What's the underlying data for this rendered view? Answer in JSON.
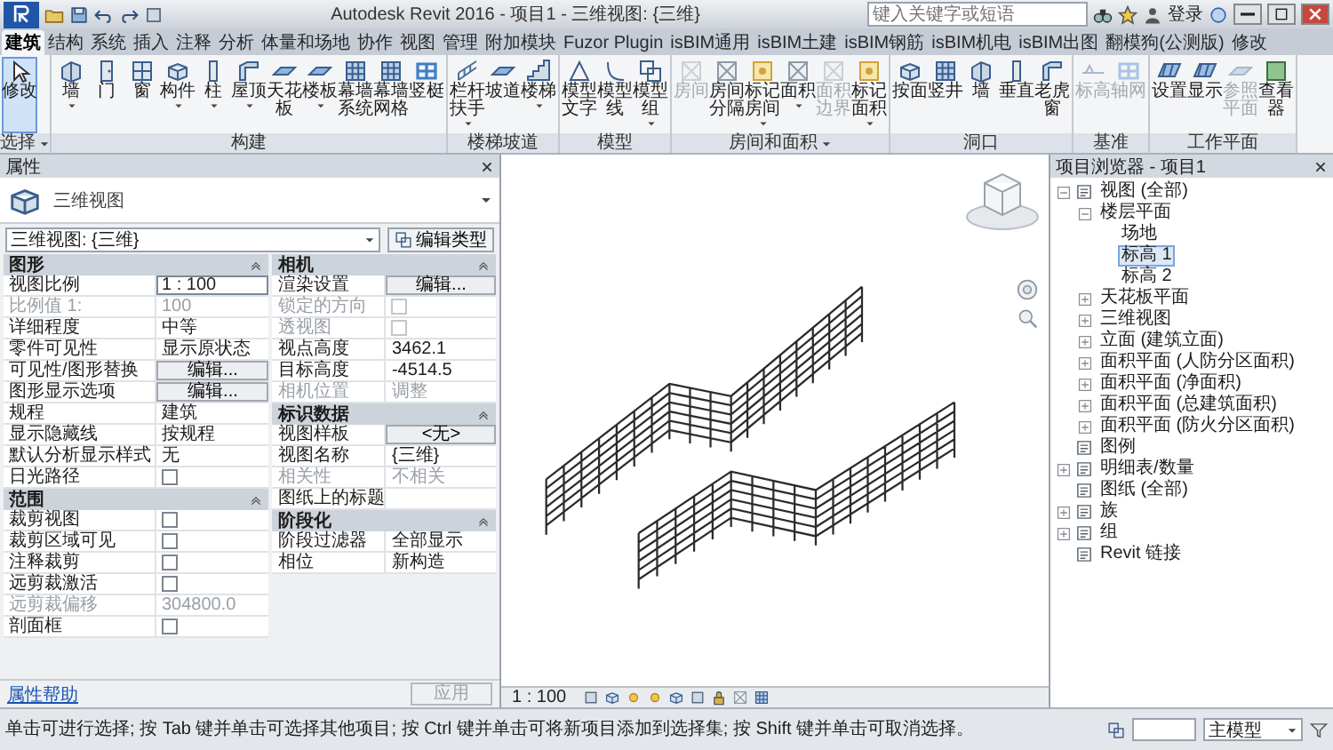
{
  "title_bar": {
    "title": "Autodesk Revit 2016 -   项目1 - 三维视图: {三维}",
    "search": {
      "placeholder": "键入关键字或短语"
    },
    "login": "登录"
  },
  "ribbon_tabs": [
    {
      "label": "建筑",
      "selected": true
    },
    {
      "label": "结构",
      "selected": false
    },
    {
      "label": "系统",
      "selected": false
    },
    {
      "label": "插入",
      "selected": false
    },
    {
      "label": "注释",
      "selected": false
    },
    {
      "label": "分析",
      "selected": false
    },
    {
      "label": "体量和场地",
      "selected": false
    },
    {
      "label": "协作",
      "selected": false
    },
    {
      "label": "视图",
      "selected": false
    },
    {
      "label": "管理",
      "selected": false
    },
    {
      "label": "附加模块",
      "selected": false
    },
    {
      "label": "Fuzor Plugin",
      "selected": false
    },
    {
      "label": "isBIM通用",
      "selected": false
    },
    {
      "label": "isBIM土建",
      "selected": false
    },
    {
      "label": "isBIM钢筋",
      "selected": false
    },
    {
      "label": "isBIM机电",
      "selected": false
    },
    {
      "label": "isBIM出图",
      "selected": false
    },
    {
      "label": "翻模狗(公测版)",
      "selected": false
    },
    {
      "label": "修改",
      "selected": false
    }
  ],
  "ribbon_panels": [
    {
      "name": "选择",
      "has_menu": true,
      "tools": [
        {
          "label": "修改",
          "active": true,
          "disabled": false,
          "dropdown": false
        }
      ]
    },
    {
      "name": "构建",
      "has_menu": false,
      "tools": [
        {
          "label": "墙",
          "active": false,
          "disabled": false,
          "dropdown": true
        },
        {
          "label": "门",
          "active": false,
          "disabled": false,
          "dropdown": false
        },
        {
          "label": "窗",
          "active": false,
          "disabled": false,
          "dropdown": false
        },
        {
          "label": "构件",
          "active": false,
          "disabled": false,
          "dropdown": true
        },
        {
          "label": "柱",
          "active": false,
          "disabled": false,
          "dropdown": true
        },
        {
          "label": "屋顶",
          "active": false,
          "disabled": false,
          "dropdown": true
        },
        {
          "label": "天花板",
          "active": false,
          "disabled": false,
          "dropdown": false
        },
        {
          "label": "楼板",
          "active": false,
          "disabled": false,
          "dropdown": true
        },
        {
          "label": "幕墙系统",
          "active": false,
          "disabled": false,
          "dropdown": false
        },
        {
          "label": "幕墙网格",
          "active": false,
          "disabled": false,
          "dropdown": false
        },
        {
          "label": "竖梃",
          "active": false,
          "disabled": false,
          "dropdown": false
        }
      ]
    },
    {
      "name": "楼梯坡道",
      "has_menu": false,
      "tools": [
        {
          "label": "栏杆扶手",
          "active": false,
          "disabled": false,
          "dropdown": true
        },
        {
          "label": "坡道",
          "active": false,
          "disabled": false,
          "dropdown": false
        },
        {
          "label": "楼梯",
          "active": false,
          "disabled": false,
          "dropdown": true
        }
      ]
    },
    {
      "name": "模型",
      "has_menu": false,
      "tools": [
        {
          "label": "模型文字",
          "active": false,
          "disabled": false,
          "dropdown": false
        },
        {
          "label": "模型线",
          "active": false,
          "disabled": false,
          "dropdown": false
        },
        {
          "label": "模型组",
          "active": false,
          "disabled": false,
          "dropdown": true
        }
      ]
    },
    {
      "name": "房间和面积",
      "has_menu": true,
      "tools": [
        {
          "label": "房间",
          "active": false,
          "disabled": true,
          "dropdown": false
        },
        {
          "label": "房间分隔",
          "active": false,
          "disabled": false,
          "dropdown": false
        },
        {
          "label": "标记房间",
          "active": false,
          "disabled": false,
          "dropdown": true
        },
        {
          "label": "面积",
          "active": false,
          "disabled": false,
          "dropdown": true
        },
        {
          "label": "面积边界",
          "active": false,
          "disabled": true,
          "dropdown": false
        },
        {
          "label": "标记面积",
          "active": false,
          "disabled": false,
          "dropdown": true
        }
      ]
    },
    {
      "name": "洞口",
      "has_menu": false,
      "tools": [
        {
          "label": "按面",
          "active": false,
          "disabled": false,
          "dropdown": false
        },
        {
          "label": "竖井",
          "active": false,
          "disabled": false,
          "dropdown": false
        },
        {
          "label": "墙",
          "active": false,
          "disabled": false,
          "dropdown": false
        },
        {
          "label": "垂直",
          "active": false,
          "disabled": false,
          "dropdown": false
        },
        {
          "label": "老虎窗",
          "active": false,
          "disabled": false,
          "dropdown": false
        }
      ]
    },
    {
      "name": "基准",
      "has_menu": false,
      "tools": [
        {
          "label": "标高",
          "active": false,
          "disabled": true,
          "dropdown": false
        },
        {
          "label": "轴网",
          "active": false,
          "disabled": true,
          "dropdown": false
        }
      ]
    },
    {
      "name": "工作平面",
      "has_menu": false,
      "tools": [
        {
          "label": "设置",
          "active": false,
          "disabled": false,
          "dropdown": false
        },
        {
          "label": "显示",
          "active": false,
          "disabled": false,
          "dropdown": false
        },
        {
          "label": "参照平面",
          "active": false,
          "disabled": true,
          "dropdown": false
        },
        {
          "label": "查看器",
          "active": false,
          "disabled": false,
          "dropdown": false
        }
      ]
    }
  ],
  "properties": {
    "title": "属性",
    "type_name": "三维视图",
    "type_selector": "三维视图: {三维}",
    "edit_type": "编辑类型",
    "groups": [
      {
        "name": "图形",
        "rows": [
          {
            "label": "视图比例",
            "kind": "field",
            "value": "1 : 100",
            "disabled": false
          },
          {
            "label": "比例值 1:",
            "kind": "text",
            "value": "100",
            "disabled": true
          },
          {
            "label": "详细程度",
            "kind": "text",
            "value": "中等",
            "disabled": false
          },
          {
            "label": "零件可见性",
            "kind": "text",
            "value": "显示原状态",
            "disabled": false
          },
          {
            "label": "可见性/图形替换",
            "kind": "button",
            "value": "编辑...",
            "disabled": false
          },
          {
            "label": "图形显示选项",
            "kind": "button",
            "value": "编辑...",
            "disabled": false
          },
          {
            "label": "规程",
            "kind": "text",
            "value": "建筑",
            "disabled": false
          },
          {
            "label": "显示隐藏线",
            "kind": "text",
            "value": "按规程",
            "disabled": false
          },
          {
            "label": "默认分析显示样式",
            "kind": "text",
            "value": "无",
            "disabled": false
          },
          {
            "label": "日光路径",
            "kind": "checkbox",
            "checked": false,
            "disabled": false
          }
        ]
      },
      {
        "name": "范围",
        "rows": [
          {
            "label": "裁剪视图",
            "kind": "checkbox",
            "checked": false,
            "disabled": false
          },
          {
            "label": "裁剪区域可见",
            "kind": "checkbox",
            "checked": false,
            "disabled": false
          },
          {
            "label": "注释裁剪",
            "kind": "checkbox",
            "checked": false,
            "disabled": false
          },
          {
            "label": "远剪裁激活",
            "kind": "checkbox",
            "checked": false,
            "disabled": false
          },
          {
            "label": "远剪裁偏移",
            "kind": "text",
            "value": "304800.0",
            "disabled": true
          },
          {
            "label": "剖面框",
            "kind": "checkbox",
            "checked": false,
            "disabled": false
          }
        ]
      },
      {
        "name": "相机",
        "rows": [
          {
            "label": "渲染设置",
            "kind": "button",
            "value": "编辑...",
            "disabled": false
          },
          {
            "label": "锁定的方向",
            "kind": "checkbox",
            "checked": false,
            "disabled": true
          },
          {
            "label": "透视图",
            "kind": "checkbox",
            "checked": false,
            "disabled": true
          },
          {
            "label": "视点高度",
            "kind": "text",
            "value": "3462.1",
            "disabled": false
          },
          {
            "label": "目标高度",
            "kind": "text",
            "value": "-4514.5",
            "disabled": false
          },
          {
            "label": "相机位置",
            "kind": "text",
            "value": "调整",
            "disabled": true
          }
        ]
      },
      {
        "name": "标识数据",
        "rows": [
          {
            "label": "视图样板",
            "kind": "button",
            "value": "<无>",
            "disabled": false
          },
          {
            "label": "视图名称",
            "kind": "text",
            "value": "{三维}",
            "disabled": false
          },
          {
            "label": "相关性",
            "kind": "text",
            "value": "不相关",
            "disabled": true
          },
          {
            "label": "图纸上的标题",
            "kind": "text",
            "disabled": false
          }
        ]
      },
      {
        "name": "阶段化",
        "rows": [
          {
            "label": "阶段过滤器",
            "kind": "text",
            "value": "全部显示",
            "disabled": false
          },
          {
            "label": "相位",
            "kind": "text",
            "value": "新构造",
            "disabled": false
          }
        ]
      }
    ],
    "help_link": "属性帮助",
    "apply": {
      "label": "应用",
      "disabled": true
    }
  },
  "viewport": {
    "scale": "1 : 100"
  },
  "project_browser": {
    "title": "项目浏览器 - 项目1",
    "tree": [
      {
        "label": "视图 (全部)",
        "expanded": true,
        "selected": false,
        "children": [
          {
            "label": "楼层平面",
            "expanded": true,
            "selected": false,
            "children": [
              {
                "label": "场地",
                "selected": false
              },
              {
                "label": "标高 1",
                "selected": true
              },
              {
                "label": "标高 2",
                "selected": false
              }
            ]
          },
          {
            "label": "天花板平面",
            "expanded": false,
            "selected": false
          },
          {
            "label": "三维视图",
            "expanded": false,
            "selected": false
          },
          {
            "label": "立面 (建筑立面)",
            "expanded": false,
            "selected": false
          },
          {
            "label": "面积平面 (人防分区面积)",
            "expanded": false,
            "selected": false
          },
          {
            "label": "面积平面 (净面积)",
            "expanded": false,
            "selected": false
          },
          {
            "label": "面积平面 (总建筑面积)",
            "expanded": false,
            "selected": false
          },
          {
            "label": "面积平面 (防火分区面积)",
            "expanded": false,
            "selected": false
          }
        ]
      },
      {
        "label": "图例",
        "selected": false
      },
      {
        "label": "明细表/数量",
        "expanded": false,
        "selected": false
      },
      {
        "label": "图纸 (全部)",
        "selected": false
      },
      {
        "label": "族",
        "expanded": false,
        "selected": false
      },
      {
        "label": "组",
        "expanded": false,
        "selected": false
      },
      {
        "label": "Revit 链接",
        "selected": false
      }
    ]
  },
  "status_bar": {
    "message": "单击可进行选择; 按 Tab 键并单击可选择其他项目; 按 Ctrl 键并单击可将新项目添加到选择集; 按 Shift 键并单击可取消选择。",
    "workset": "主模型"
  }
}
